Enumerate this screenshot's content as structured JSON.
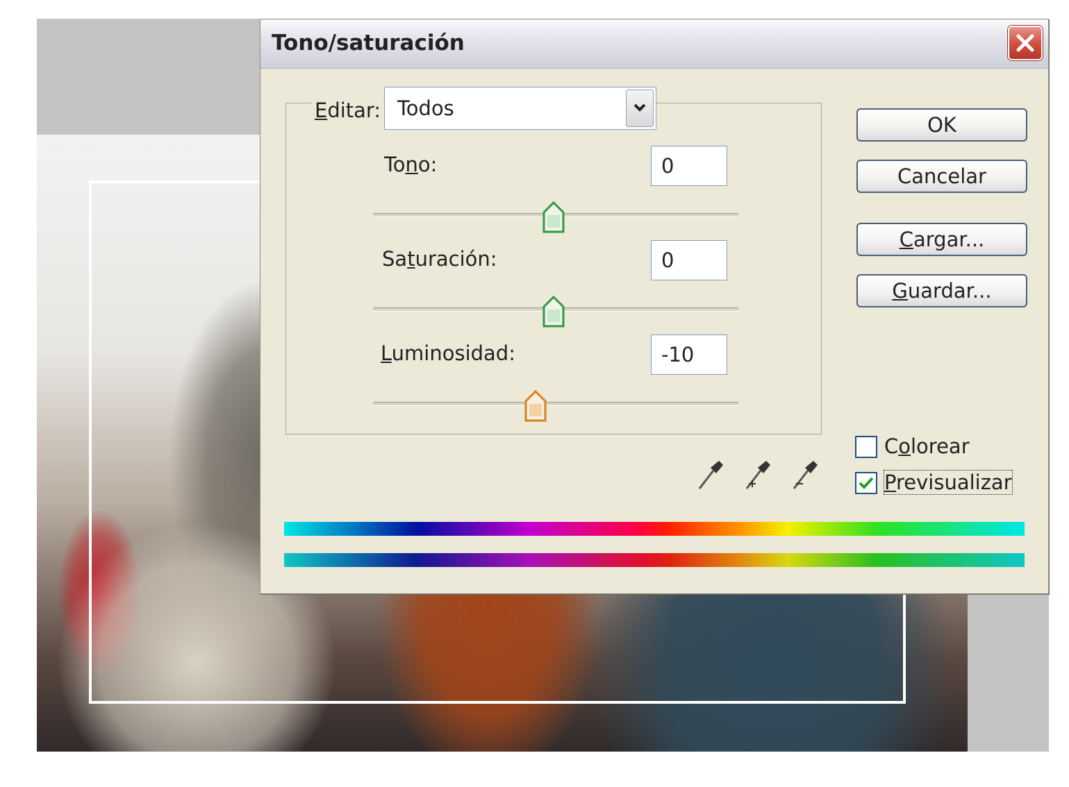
{
  "dialog": {
    "title": "Tono/saturación",
    "edit": {
      "label_prefix": "E",
      "label_rest": "ditar:",
      "value": "Todos"
    },
    "sliders": [
      {
        "label_pre": "To",
        "label_ul": "n",
        "label_post": "o:",
        "value": "0",
        "position": 0.5,
        "thumb_color": "#2e9a3e"
      },
      {
        "label_pre": "Sa",
        "label_ul": "t",
        "label_post": "uración:",
        "value": "0",
        "position": 0.5,
        "thumb_color": "#2e9a3e"
      },
      {
        "label_pre": "",
        "label_ul": "L",
        "label_post": "uminosidad:",
        "value": "-10",
        "position": 0.45,
        "thumb_color": "#d9801a"
      }
    ],
    "buttons": {
      "ok": "OK",
      "cancel": "Cancelar",
      "load_ul": "C",
      "load_rest": "argar...",
      "save_ul": "G",
      "save_rest": "uardar..."
    },
    "checkboxes": {
      "colorize_pre": "C",
      "colorize_ul": "o",
      "colorize_post": "lorear",
      "colorize_checked": false,
      "preview_ul": "P",
      "preview_rest": "revisualizar",
      "preview_checked": true
    },
    "eyedroppers": [
      "eyedropper-icon",
      "eyedropper-plus-icon",
      "eyedropper-minus-icon"
    ],
    "colors": {
      "close_button": "#d04b3c",
      "dialog_bg": "#ece9d8",
      "button_border": "#4a5f7a"
    }
  }
}
